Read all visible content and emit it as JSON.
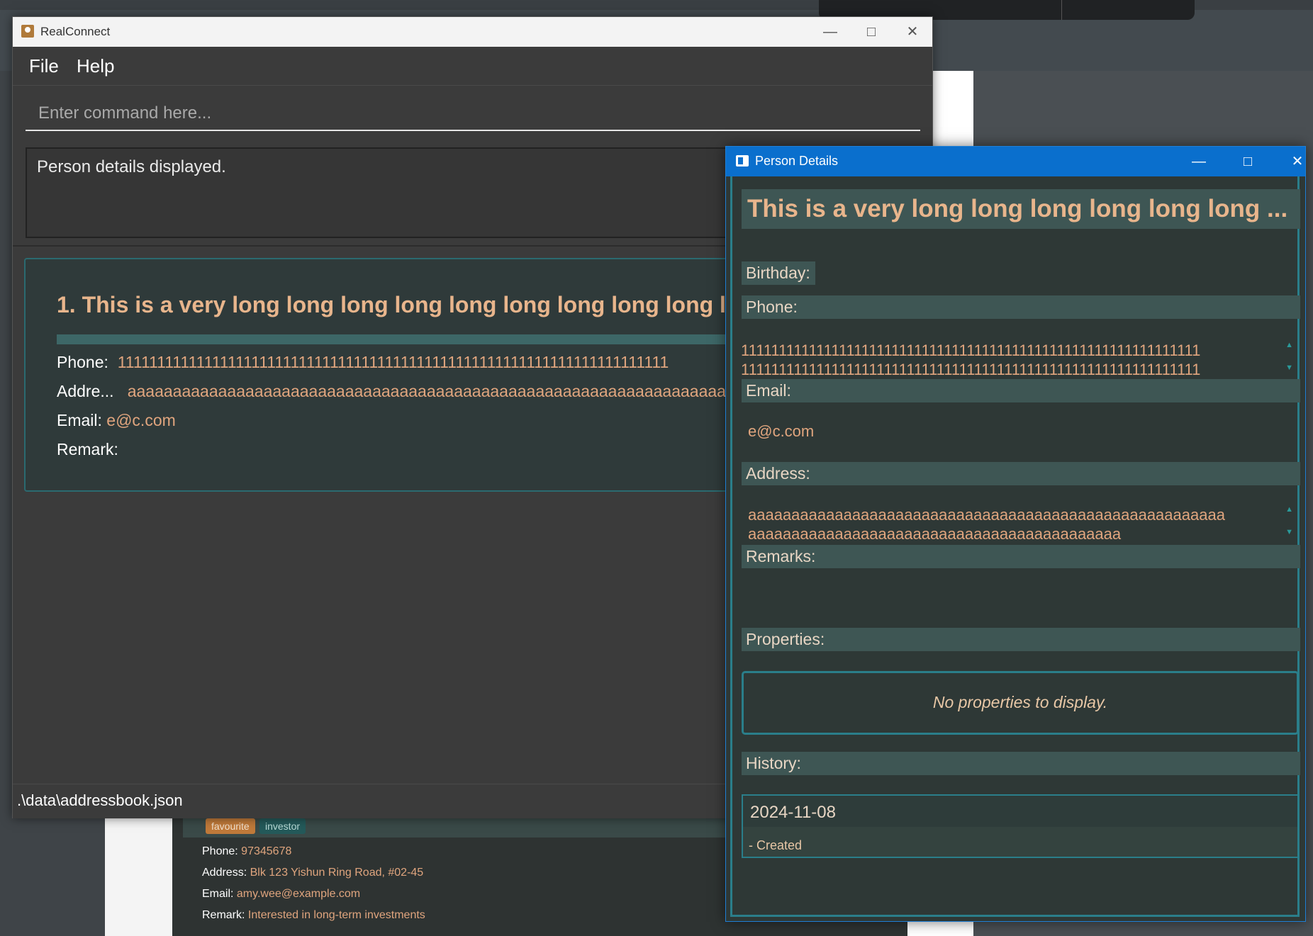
{
  "main_window": {
    "title": "RealConnect",
    "menu": [
      "File",
      "Help"
    ],
    "command_placeholder": "Enter command here...",
    "result_text": "Person details displayed.",
    "status_path": ".\\data\\addressbook.json",
    "person_card": {
      "index_name": "1.  This is a very long long long long long long long long long long",
      "phone_label": "Phone:",
      "phone_value": "1111111111111111111111111111111111111111111111111111111111111111111111",
      "address_label": "Addre...",
      "address_value": "aaaaaaaaaaaaaaaaaaaaaaaaaaaaaaaaaaaaaaaaaaaaaaaaaaaaaaaaaaaaaaaaaaaaaaaaa",
      "email_label": "Email:",
      "email_value": "e@c.com",
      "remark_label": "Remark:"
    }
  },
  "details_window": {
    "title": "Person Details",
    "name": "This is a very long long long long long long ...",
    "birthday_label": "Birthday:",
    "phone_label": "Phone:",
    "phone_line1": "1111111111111111111111111111111111111111111111111111111111111",
    "phone_line2": "1111111111111111111111111111111111111111111111111111111111111",
    "email_label": "Email:",
    "email_value": "e@c.com",
    "address_label": "Address:",
    "address_line1": "aaaaaaaaaaaaaaaaaaaaaaaaaaaaaaaaaaaaaaaaaaaaaaaaaaaaaaa",
    "address_line2": "aaaaaaaaaaaaaaaaaaaaaaaaaaaaaaaaaaaaaaaaaaa",
    "remarks_label": "Remarks:",
    "properties_label": "Properties:",
    "properties_empty": "No properties to display.",
    "history_label": "History:",
    "history_date": "2024-11-08",
    "history_note": "- Created"
  },
  "background_card": {
    "tags": [
      "favourite",
      "investor"
    ],
    "phone_label": "Phone:",
    "phone_value": "97345678",
    "address_label": "Address:",
    "address_value": "Blk 123 Yishun Ring Road, #02-45",
    "email_label": "Email:",
    "email_value": "amy.wee@example.com",
    "remark_label": "Remark:",
    "remark_value": "Interested in long-term investments"
  },
  "icons": {
    "minimize": "minimize-icon",
    "maximize": "maximize-icon",
    "close": "close-icon",
    "app": "realconnect-app-icon",
    "window": "person-details-window-icon"
  },
  "colors": {
    "accent_orange": "#e0a57e",
    "details_titlebar": "#0a6fcd",
    "teal_border": "#2a7e8a",
    "section_bg": "#3e5654"
  }
}
